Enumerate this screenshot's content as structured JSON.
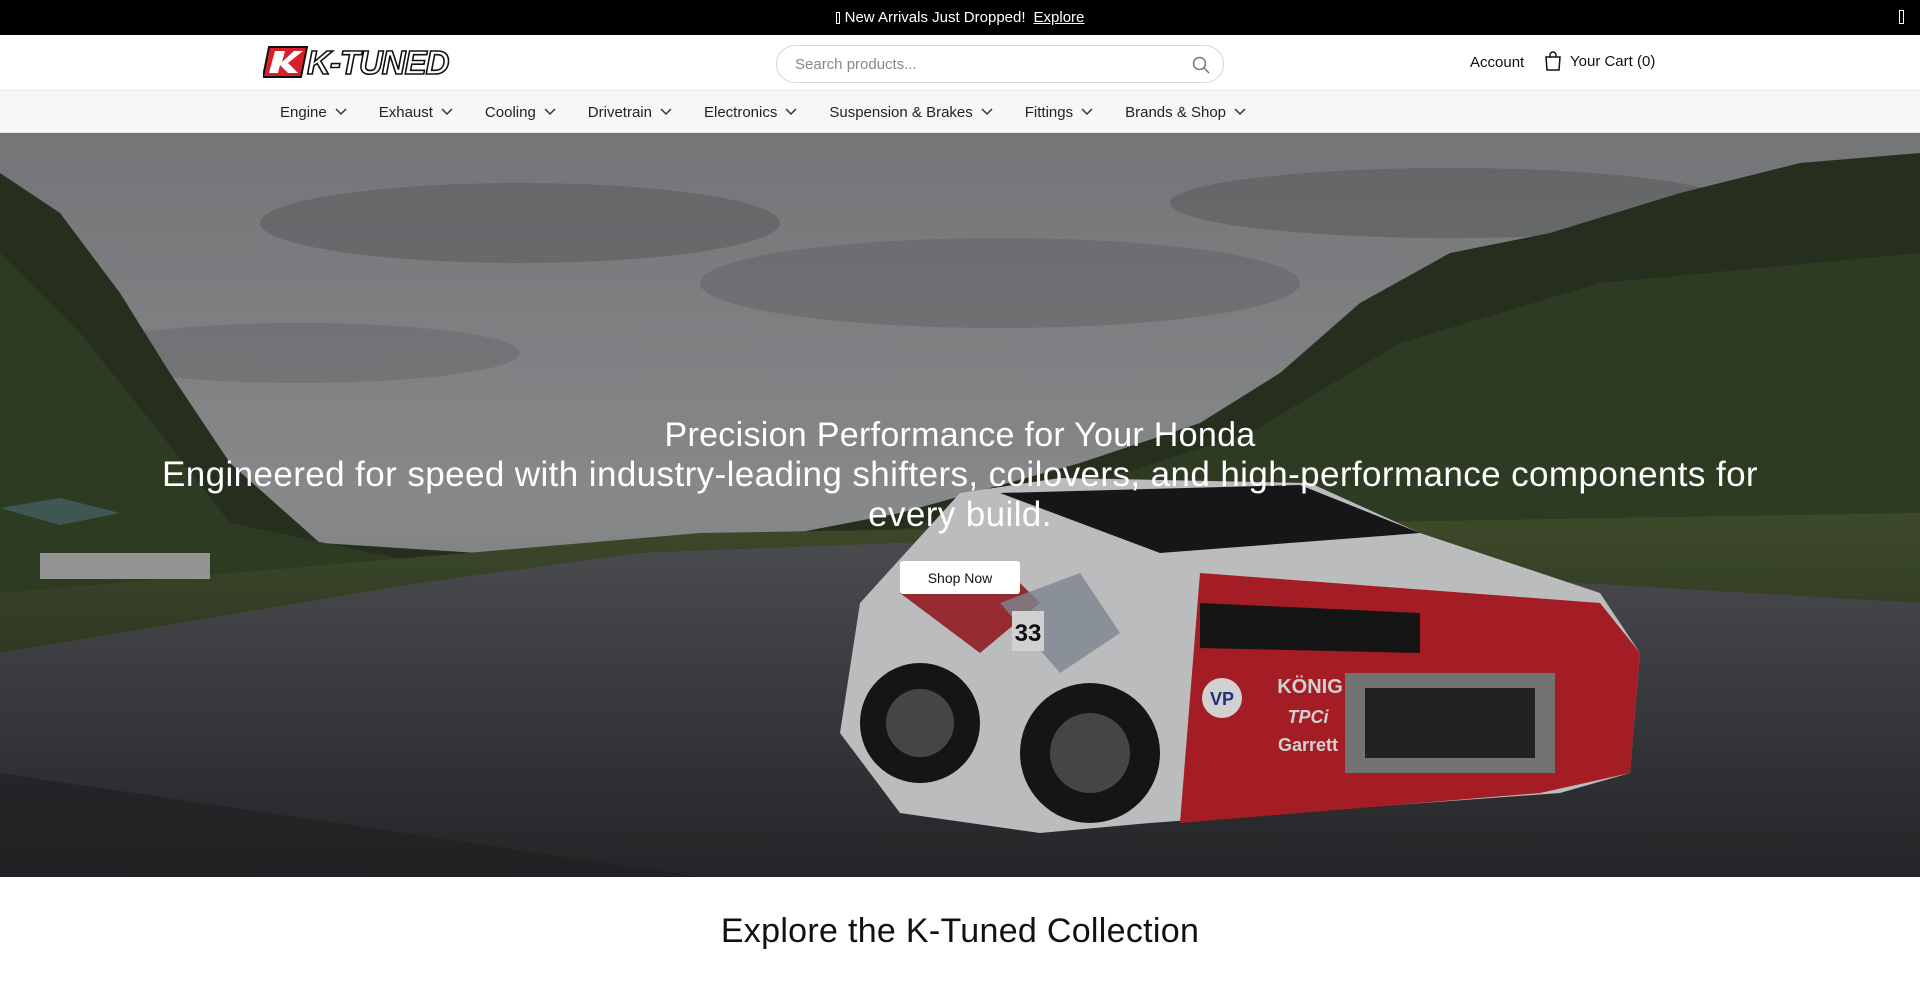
{
  "announcement": {
    "text": "New Arrivals Just Dropped!",
    "link_label": "Explore"
  },
  "header": {
    "logo_text": "K-TUNED",
    "search": {
      "placeholder": "Search products...",
      "value": ""
    },
    "account_label": "Account",
    "cart_label": "Your Cart (0)",
    "icons": [
      "search-icon",
      "bag-icon"
    ]
  },
  "nav": {
    "items": [
      {
        "label": "Engine"
      },
      {
        "label": "Exhaust"
      },
      {
        "label": "Cooling"
      },
      {
        "label": "Drivetrain"
      },
      {
        "label": "Electronics"
      },
      {
        "label": "Suspension & Brakes"
      },
      {
        "label": "Fittings"
      },
      {
        "label": "Brands & Shop"
      }
    ]
  },
  "hero": {
    "title": "Precision Performance for Your Honda",
    "subtitle": "Engineered for speed with industry-leading shifters, coilovers, and high-performance components for every build.",
    "button_label": "Shop Now",
    "car_number": "33",
    "car_sponsors": [
      "KÖNIG",
      "TPCi",
      "Garrett",
      "VP"
    ]
  },
  "collection": {
    "title": "Explore the K-Tuned Collection"
  },
  "colors": {
    "brand_red": "#d8202a",
    "announce_bg": "#000000",
    "nav_bg": "#f7f7f7"
  }
}
